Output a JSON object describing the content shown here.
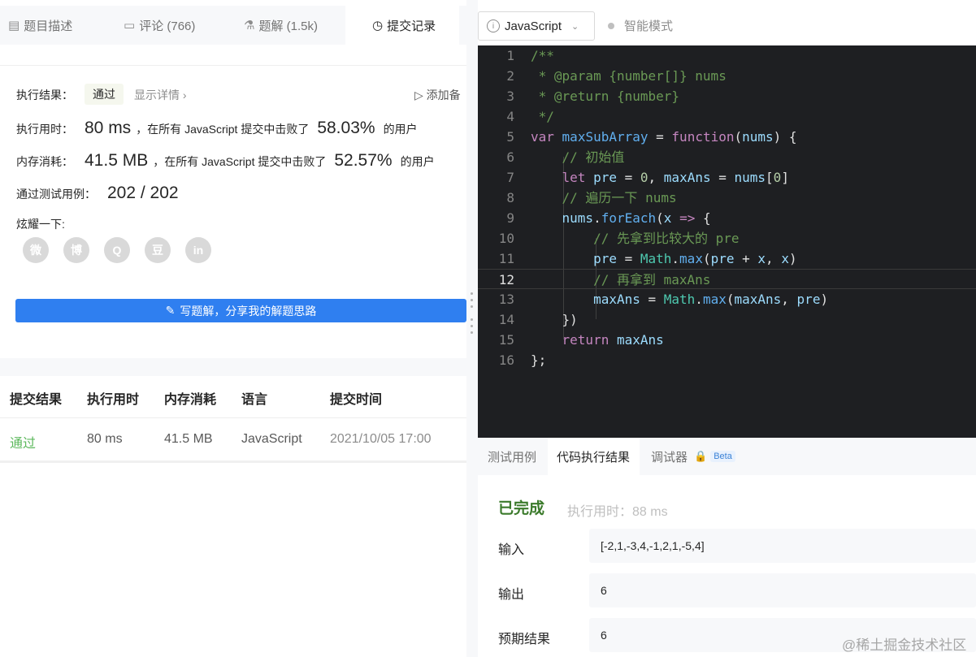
{
  "left_tabs": [
    {
      "icon": "description-icon",
      "label": "题目描述"
    },
    {
      "icon": "comment-icon",
      "label": "评论 (766)"
    },
    {
      "icon": "flask-icon",
      "label": "题解 (1.5k)"
    },
    {
      "icon": "clock-icon",
      "label": "提交记录"
    }
  ],
  "result": {
    "exec_result_label": "执行结果：",
    "status": "通过",
    "details_link": "显示详情 ›",
    "add_note": "添加备",
    "runtime_label": "执行用时：",
    "runtime_value": "80 ms",
    "beat_text": "，在所有 JavaScript 提交中击败了",
    "runtime_percent": "58.03%",
    "users_text": "的用户",
    "memory_label": "内存消耗：",
    "memory_value": "41.5 MB",
    "memory_percent": "52.57%",
    "testcases_label": "通过测试用例：",
    "testcases_value": "202 / 202",
    "share_label": "炫耀一下:",
    "share_icons": [
      "wechat-icon",
      "weibo-icon",
      "qq-icon",
      "douban-icon",
      "linkedin-icon"
    ],
    "share_glyphs": [
      "微",
      "博",
      "Q",
      "豆",
      "in"
    ],
    "write_solution": "写题解，分享我的解题思路"
  },
  "submissions": {
    "headers": [
      "提交结果",
      "执行用时",
      "内存消耗",
      "语言",
      "提交时间"
    ],
    "rows": [
      [
        "通过",
        "80 ms",
        "41.5 MB",
        "JavaScript",
        "2021/10/05 17:00"
      ]
    ]
  },
  "editor": {
    "language": "JavaScript",
    "smart_mode": "智能模式",
    "active_line": 12,
    "lines": [
      "/**",
      " * @param {number[]} nums",
      " * @return {number}",
      " */",
      "var maxSubArray = function(nums) {",
      "    // 初始值",
      "    let pre = 0, maxAns = nums[0]",
      "    // 遍历一下 nums",
      "    nums.forEach(x => {",
      "        // 先拿到比较大的 pre",
      "        pre = Math.max(pre + x, x)",
      "        // 再拿到 maxAns",
      "        maxAns = Math.max(maxAns, pre)",
      "    })",
      "    return maxAns",
      "};"
    ]
  },
  "run_panel": {
    "tabs": [
      "测试用例",
      "代码执行结果",
      "调试器"
    ],
    "beta": "Beta",
    "status": "已完成",
    "exec_time": "执行用时：88 ms",
    "input_label": "输入",
    "input_value": "[-2,1,-3,4,-1,2,1,-5,4]",
    "output_label": "输出",
    "output_value": "6",
    "expected_label": "预期结果",
    "expected_value": "6"
  },
  "watermark": "@稀土掘金技术社区"
}
